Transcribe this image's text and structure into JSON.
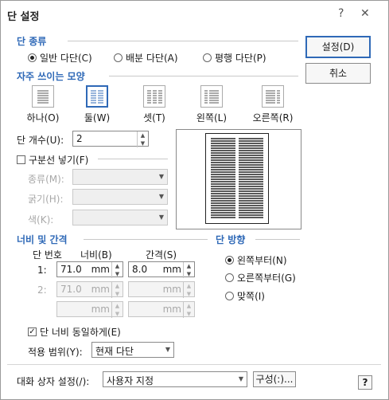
{
  "window": {
    "title": "단 설정",
    "help_glyph": "?",
    "close_glyph": "✕"
  },
  "column_type": {
    "heading": "단 종류",
    "options": [
      {
        "label": "일반 다단(C)",
        "selected": true
      },
      {
        "label": "배분 다단(A)",
        "selected": false
      },
      {
        "label": "평행 다단(P)",
        "selected": false
      }
    ]
  },
  "presets": {
    "heading": "자주 쓰이는 모양",
    "items": [
      {
        "label": "하나(O)",
        "selected": false
      },
      {
        "label": "둘(W)",
        "selected": true
      },
      {
        "label": "셋(T)",
        "selected": false
      },
      {
        "label": "왼쪽(L)",
        "selected": false
      },
      {
        "label": "오른쪽(R)",
        "selected": false
      }
    ]
  },
  "column_count": {
    "label": "단 개수(U):",
    "value": "2"
  },
  "divider": {
    "label": "구분선 넣기(F)",
    "checked": false,
    "type_label": "종류(M):",
    "thickness_label": "굵기(H):",
    "color_label": "색(K):"
  },
  "width_spacing": {
    "heading": "너비 및 간격",
    "col_header_number": "단 번호",
    "col_header_width": "너비(B)",
    "col_header_spacing": "간격(S)",
    "rows": [
      {
        "number": "1:",
        "width": "71.0",
        "width_unit": "mm",
        "spacing": "8.0",
        "spacing_unit": "mm"
      },
      {
        "number": "2:",
        "width": "71.0",
        "width_unit": "mm",
        "spacing": "",
        "spacing_unit": "mm"
      },
      {
        "number": "",
        "width": "",
        "width_unit": "mm",
        "spacing": "",
        "spacing_unit": "mm"
      }
    ]
  },
  "direction": {
    "heading": "단 방향",
    "options": [
      {
        "label": "왼쪽부터(N)",
        "selected": true
      },
      {
        "label": "오른쪽부터(G)",
        "selected": false
      },
      {
        "label": "맞쪽(I)",
        "selected": false
      }
    ]
  },
  "equal_width": {
    "label": "단 너비 동일하게(E)",
    "checked": true
  },
  "apply_scope": {
    "label": "적용 범위(Y):",
    "value": "현재 다단"
  },
  "footer": {
    "dialog_settings_label": "대화 상자 설정(/):",
    "dialog_settings_value": "사용자 지정",
    "configure_button": "구성(:)...",
    "help_button": "?"
  },
  "buttons": {
    "ok": "설정(D)",
    "cancel": "취소"
  },
  "preview": {
    "columns": 2,
    "accent": "#2f69b7"
  }
}
